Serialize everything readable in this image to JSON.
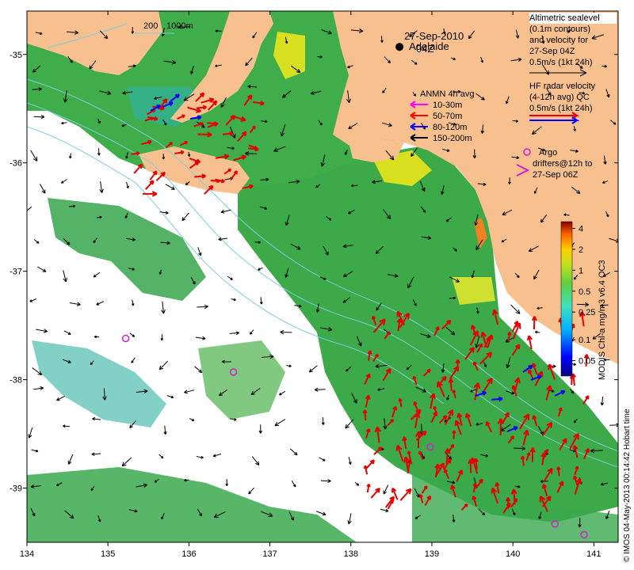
{
  "chart_data": {
    "type": "map",
    "title": "27-Sep-2010",
    "subtitle": "04Z",
    "x_ticks": [
      "134",
      "135",
      "136",
      "137",
      "138",
      "139",
      "140",
      "141"
    ],
    "y_ticks": [
      "-35",
      "-36",
      "-37",
      "-38",
      "-39"
    ],
    "xlim": [
      134,
      141.3
    ],
    "ylim": [
      -39.5,
      -34.6
    ],
    "city": {
      "name": "Adelaide",
      "lon": 138.6,
      "lat": -34.93
    },
    "scale_bar": {
      "label_1": "200",
      "label_2": "1000m"
    },
    "colorbar": {
      "label": "MODIS Chl-a mg/m3 v6.4 OC3",
      "ticks": [
        "4",
        "2",
        "1",
        "0.5",
        "0.25",
        "0.1",
        "0.05"
      ],
      "tick_values": [
        4,
        2,
        1,
        0.5,
        0.25,
        0.1,
        0.05
      ],
      "range": [
        0.03,
        5
      ],
      "scale": "log"
    },
    "legend": {
      "altimetric": [
        "Altimetric sealevel",
        "(0.1m contours)",
        "and velocity for",
        "27-Sep 04Z",
        "0.5m/s (1kt 24h)"
      ],
      "hf_radar": [
        "HF radar velocity",
        "(4-12h avg) QC",
        "0.5m/s (1kt 24h)"
      ],
      "anmn_title": "ANMN 4h avg",
      "anmn_items": [
        {
          "label": "10-30m",
          "color": "#ff00ff"
        },
        {
          "label": "50-70m",
          "color": "#ff0000"
        },
        {
          "label": "80-120m",
          "color": "#0000ff"
        },
        {
          "label": "150-200m",
          "color": "#000000"
        }
      ],
      "argo": [
        "Argo",
        "drifters@12h to",
        "27-Sep 06Z"
      ]
    },
    "argo_points": [
      {
        "lon": 135.22,
        "lat": -37.62
      },
      {
        "lon": 136.55,
        "lat": -37.93
      },
      {
        "lon": 138.98,
        "lat": -38.62
      },
      {
        "lon": 140.52,
        "lat": -39.33
      },
      {
        "lon": 140.88,
        "lat": -39.43
      }
    ],
    "credit": "© IMOS 04-May-2013 00:14:42 Hobart time"
  },
  "colors": {
    "land": "#f7c08e",
    "ocean_no_data": "#ffffff",
    "chl_green": "#3fae4a",
    "chl_teal": "#2fb0a0",
    "chl_yellow": "#d8e020",
    "hf_radar": "#e60000",
    "argo": "#d020d0"
  }
}
